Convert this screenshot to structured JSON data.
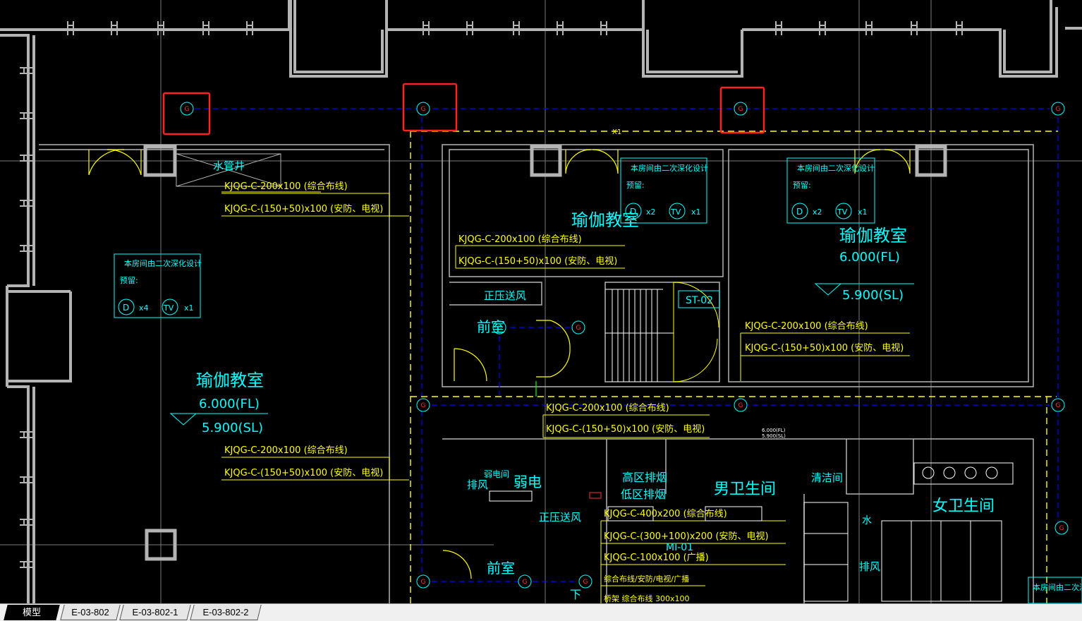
{
  "colors": {
    "background": "#000000",
    "wall": "#b4b4b4",
    "yellow": "#ffff00",
    "cyan": "#00ffff",
    "axis_blue": "#0000ff",
    "red_mark": "#ff3030",
    "highlight_box": "#ff2222",
    "green": "#00ff00"
  },
  "cad": {
    "grid_bubble_label": "G",
    "rooms": {
      "yoga_left_name": "瑜伽教室",
      "yoga_left_fl": "6.000(FL)",
      "yoga_left_sl": "5.900(SL)",
      "yoga_mid_name": "瑜伽教室",
      "yoga_right_name": "瑜伽教室",
      "yoga_right_fl": "6.000(FL)",
      "yoga_right_sl": "5.900(SL)",
      "water_shaft": "水管井",
      "front_room_1": "前室",
      "front_room_2": "前室",
      "pressurized_air_1": "正压送风",
      "pressurized_air_2": "正压送风",
      "stair_tag": "ST-02",
      "weak_current": "弱电",
      "weak_room": "弱电间",
      "exhaust_1": "排风",
      "exhaust_2": "排风",
      "smoke_high": "高区排烟",
      "smoke_low": "低区排烟",
      "mens_wc": "男卫生间",
      "womens_wc": "女卫生间",
      "cleaning": "清洁间",
      "water": "水",
      "down": "下",
      "pipe_tag": "MI-01"
    },
    "notes": {
      "note_title": "本房间由二次深化设计",
      "reserve": "预留:",
      "d_symbol": "D",
      "tv_symbol": "TV",
      "left_d_count": "x4",
      "left_tv_count": "x1",
      "mid_d_count": "x2",
      "mid_tv_count": "x1",
      "right_d_count": "x2",
      "right_tv_count": "x1",
      "x1_mark": "X1",
      "small_level_a": "6.000(FL)",
      "small_level_b": "5.900(SL)"
    },
    "trays": {
      "t200": "KJQG-C-200x100 (综合布线)",
      "t150": "KJQG-C-(150+50)x100 (安防、电视)",
      "t150_alt": "KJQG-C-(150+50)x100 (安防、电视)",
      "t400": "KJQG-C-400x200 (综合布线)",
      "t300": "KJQG-C-(300+100)x200 (安防、电视)",
      "t100": "KJQG-C-100x100 (广播)",
      "t_misc1": "综合布线/安防/电视/广播",
      "t_misc2": "桥架 综合布线 300x100"
    }
  },
  "tabs": [
    "模型",
    "E-03-802",
    "E-03-802-1",
    "E-03-802-2"
  ]
}
